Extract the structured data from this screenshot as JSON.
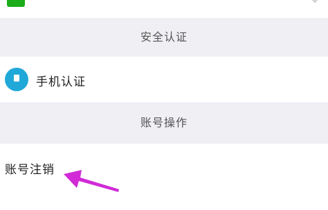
{
  "top_item": {
    "icon": "green-app-icon",
    "label": "",
    "chevron": "chevron-right-icon"
  },
  "sections": {
    "security": {
      "header": "安全认证"
    },
    "account": {
      "header": "账号操作"
    }
  },
  "items": {
    "phone_auth": {
      "label": "手机认证",
      "icon": "phone-icon",
      "icon_color": "#1fa8d8"
    },
    "account_cancel": {
      "label": "账号注销"
    }
  },
  "annotation": {
    "arrow_color": "#d12ad6"
  },
  "colors": {
    "section_bg": "#efeff4",
    "text": "#222222",
    "header_text": "#555555"
  }
}
